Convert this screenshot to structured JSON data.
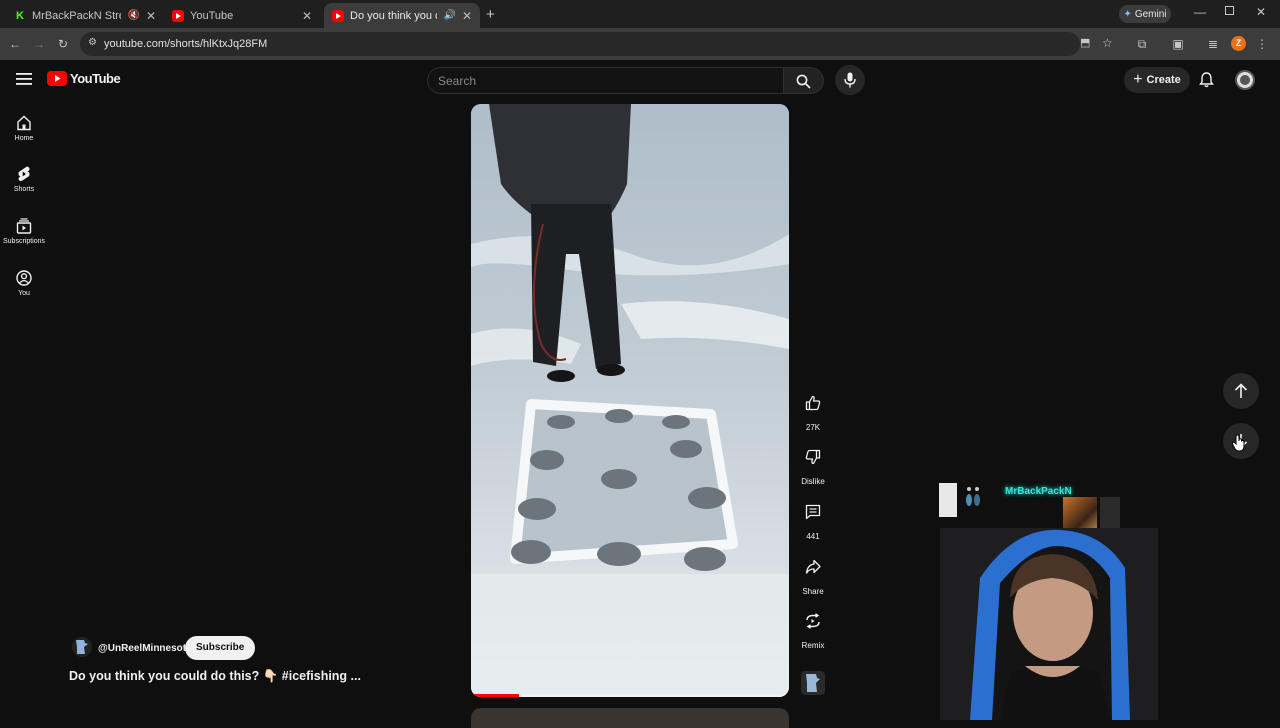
{
  "browser": {
    "tabs": [
      {
        "title": "MrBackPackN Stream - Wa",
        "favicon": "kick-icon",
        "muted": true
      },
      {
        "title": "YouTube",
        "favicon": "youtube-icon"
      },
      {
        "title": "Do you think you could do",
        "favicon": "youtube-icon",
        "active": true,
        "playing": true
      }
    ],
    "gemini_label": "Gemini",
    "url": "youtube.com/shorts/hlKtxJq28FM",
    "profile_initial": "Z"
  },
  "youtube": {
    "logo_text": "YouTube",
    "search_placeholder": "Search",
    "create_label": "Create",
    "sidebar": [
      {
        "label": "Home",
        "icon": "home-icon"
      },
      {
        "label": "Shorts",
        "icon": "shorts-icon"
      },
      {
        "label": "Subscriptions",
        "icon": "subscriptions-icon"
      },
      {
        "label": "You",
        "icon": "you-icon"
      }
    ],
    "short": {
      "channel": "@UnReelMinnesota",
      "subscribe_label": "Subscribe",
      "title": "Do you think you could do this? 👇🏻 #icefishing ...",
      "likes": "27K",
      "dislike_label": "Dislike",
      "comments": "441",
      "share_label": "Share",
      "remix_label": "Remix",
      "progress": 0.15
    }
  },
  "overlay": {
    "streamer_name": "MrBackPackN"
  },
  "colors": {
    "youtube_red": "#ff0000",
    "background": "#0f0f0f",
    "kick_green": "#53fc18",
    "profile_orange": "#e8711a",
    "overlay_name": "#39e6d0"
  }
}
